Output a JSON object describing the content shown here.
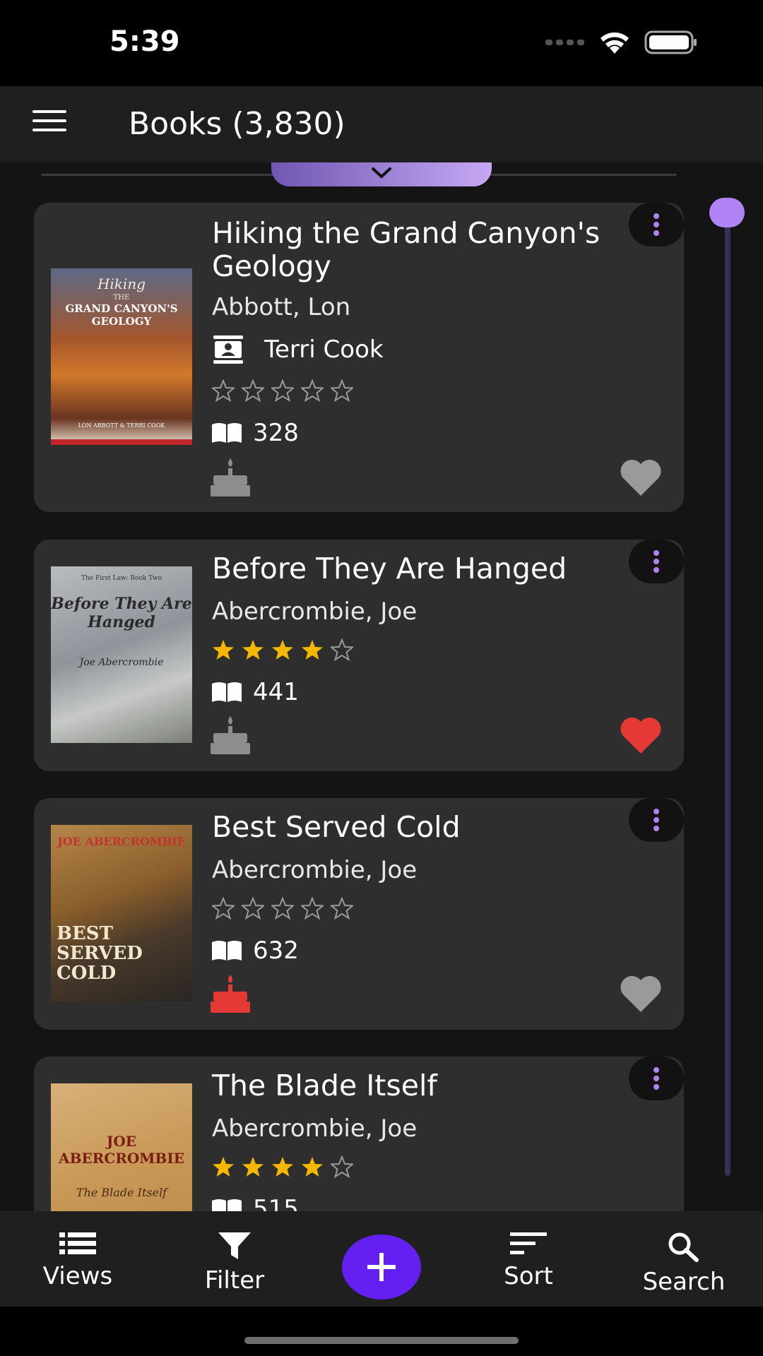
{
  "status_bar": {
    "time": "5:39"
  },
  "app_bar": {
    "title": "Books (3,830)"
  },
  "books": [
    {
      "title": "Hiking the Grand Canyon's Geology",
      "author": "Abbott, Lon",
      "narrator": "Terri Cook",
      "rating": 0,
      "max_rating": 5,
      "pages": "328",
      "favorite": false,
      "birthday_highlight": false,
      "cover": {
        "top": "Hiking",
        "small": "THE",
        "main": "GRAND CANYON'S GEOLOGY",
        "credits": "LON ABBOTT & TERRI COOK"
      }
    },
    {
      "title": "Before They Are Hanged",
      "author": "Abercrombie, Joe",
      "rating": 4,
      "max_rating": 5,
      "pages": "441",
      "favorite": true,
      "birthday_highlight": false,
      "cover": {
        "top": "The First Law: Book Two",
        "main": "Before They Are Hanged",
        "byline": "Joe Abercrombie"
      }
    },
    {
      "title": "Best Served Cold",
      "author": "Abercrombie, Joe",
      "rating": 0,
      "max_rating": 5,
      "pages": "632",
      "favorite": false,
      "birthday_highlight": true,
      "cover": {
        "top": "JOE ABERCROMBIE",
        "main": "BEST SERVED COLD"
      }
    },
    {
      "title": "The Blade Itself",
      "author": "Abercrombie, Joe",
      "rating": 4,
      "max_rating": 5,
      "pages": "515",
      "favorite": false,
      "birthday_highlight": false,
      "cover": {
        "top": "JOE ABERCROMBIE",
        "main": "The Blade Itself"
      }
    }
  ],
  "bottom_nav": {
    "views": "Views",
    "filter": "Filter",
    "add_icon": "plus-icon",
    "sort": "Sort",
    "search": "Search"
  },
  "colors": {
    "accent": "#b084f5",
    "fab": "#6420f0",
    "star_filled": "#f5b700",
    "favorite": "#e53935",
    "card": "#2e2e2e"
  }
}
